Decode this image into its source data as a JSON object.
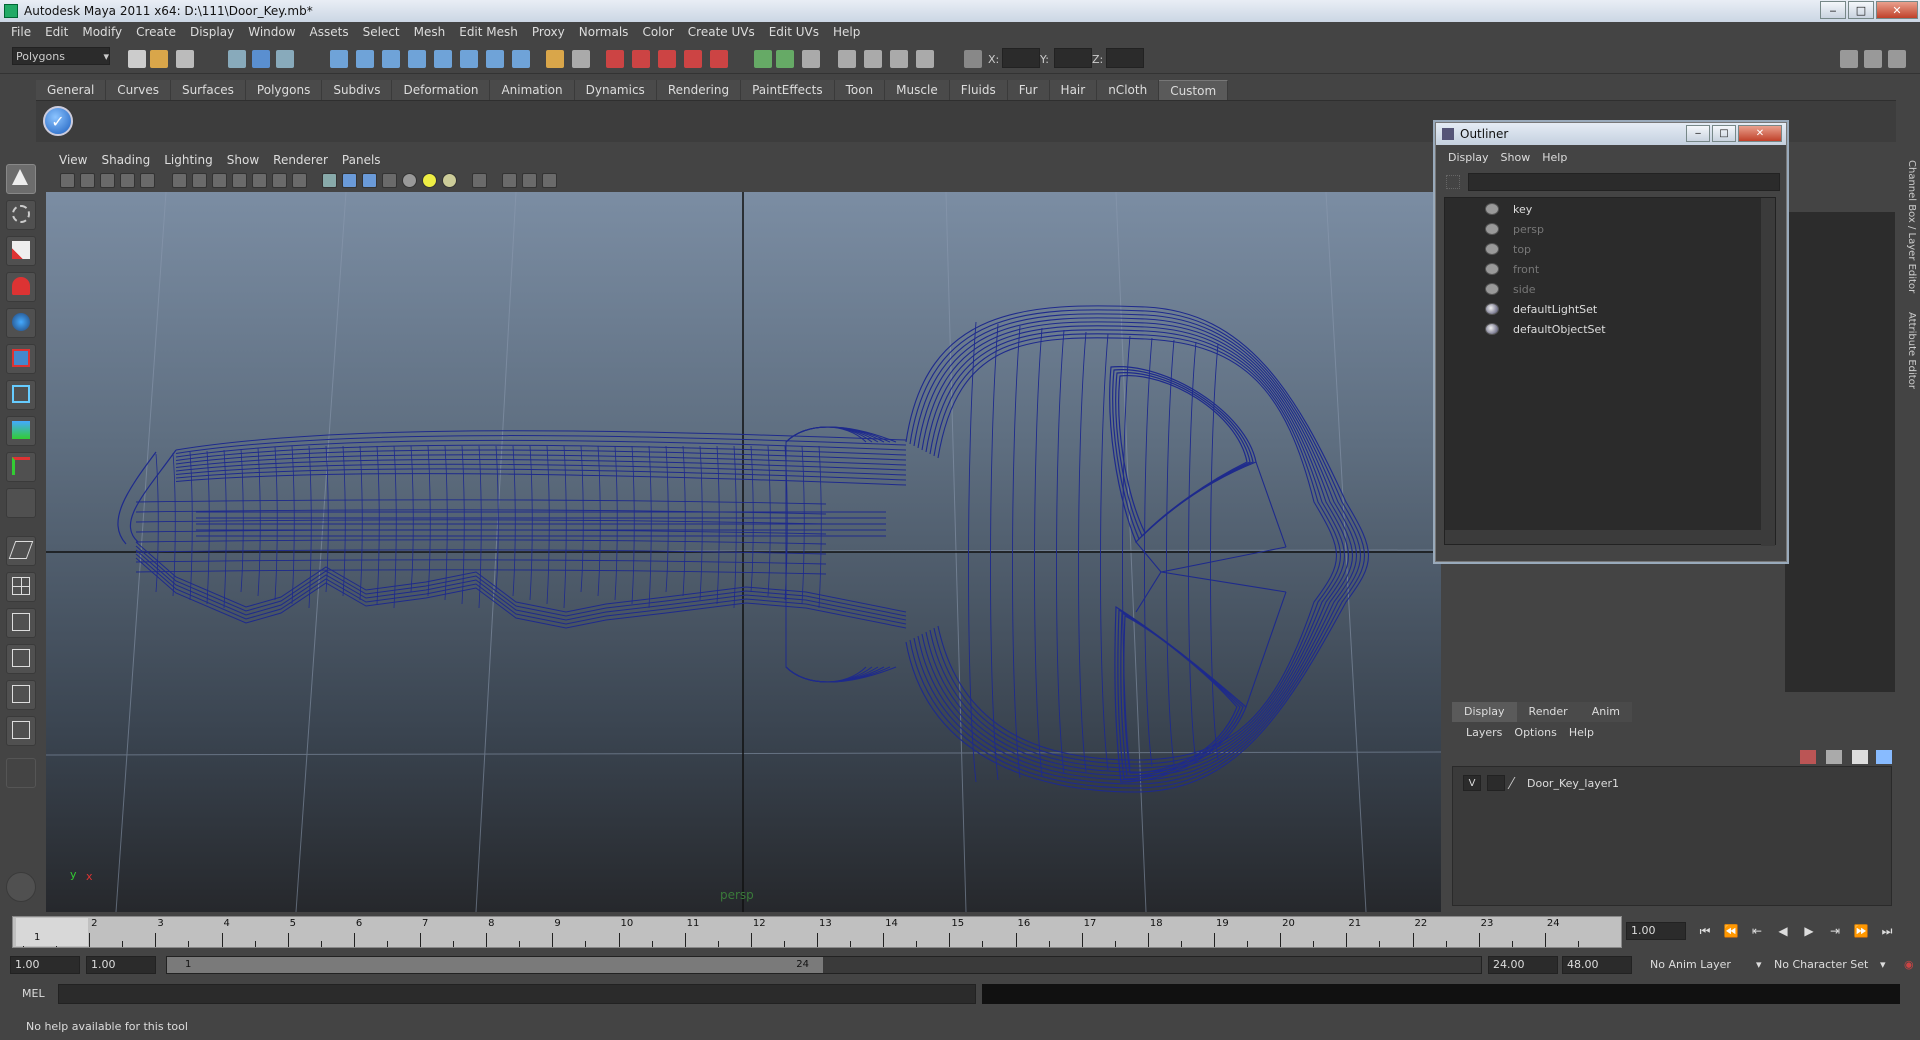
{
  "window": {
    "title": "Autodesk Maya 2011 x64: D:\\111\\Door_Key.mb*",
    "min": "‒",
    "max": "□",
    "close": "✕"
  },
  "menubar": [
    "File",
    "Edit",
    "Modify",
    "Create",
    "Display",
    "Window",
    "Assets",
    "Select",
    "Mesh",
    "Edit Mesh",
    "Proxy",
    "Normals",
    "Color",
    "Create UVs",
    "Edit UVs",
    "Help"
  ],
  "statusline": {
    "mode": "Polygons",
    "x_label": "X:",
    "y_label": "Y:",
    "z_label": "Z:"
  },
  "shelf_tabs": [
    "General",
    "Curves",
    "Surfaces",
    "Polygons",
    "Subdivs",
    "Deformation",
    "Animation",
    "Dynamics",
    "Rendering",
    "PaintEffects",
    "Toon",
    "Muscle",
    "Fluids",
    "Fur",
    "Hair",
    "nCloth",
    "Custom"
  ],
  "shelf_active": "Custom",
  "viewport": {
    "menus": [
      "View",
      "Shading",
      "Lighting",
      "Show",
      "Renderer",
      "Panels"
    ],
    "camera_label": "persp",
    "axis_x": "x",
    "axis_y": "y",
    "wire_color": "#1e2a8c"
  },
  "outliner": {
    "title": "Outliner",
    "menus": [
      "Display",
      "Show",
      "Help"
    ],
    "items": [
      {
        "label": "key",
        "dim": false,
        "icon": "mesh-icon"
      },
      {
        "label": "persp",
        "dim": true,
        "icon": "camera-icon"
      },
      {
        "label": "top",
        "dim": true,
        "icon": "camera-icon"
      },
      {
        "label": "front",
        "dim": true,
        "icon": "camera-icon"
      },
      {
        "label": "side",
        "dim": true,
        "icon": "camera-icon"
      },
      {
        "label": "defaultLightSet",
        "dim": false,
        "icon": "set-icon"
      },
      {
        "label": "defaultObjectSet",
        "dim": false,
        "icon": "set-icon"
      }
    ]
  },
  "side_tabs": [
    "Channel Box / Layer Editor",
    "Attribute Editor"
  ],
  "layers": {
    "tabs": [
      "Display",
      "Render",
      "Anim"
    ],
    "active_tab": "Display",
    "menus": [
      "Layers",
      "Options",
      "Help"
    ],
    "rows": [
      {
        "visible": "V",
        "name": "Door_Key_layer1"
      }
    ]
  },
  "timeline": {
    "ticks": [
      "1",
      "2",
      "3",
      "4",
      "5",
      "6",
      "7",
      "8",
      "9",
      "10",
      "11",
      "12",
      "13",
      "14",
      "15",
      "16",
      "17",
      "18",
      "19",
      "20",
      "21",
      "22",
      "23",
      "24"
    ],
    "current_frame_marker": "1",
    "current_time": "1.00"
  },
  "range": {
    "start": "1.00",
    "playback_start": "1.00",
    "handle_start": "1",
    "handle_end": "24",
    "playback_end": "24.00",
    "end": "48.00",
    "anim_layer": "No Anim Layer",
    "character_set": "No Character Set"
  },
  "cmdline": {
    "label": "MEL"
  },
  "help": {
    "text": "No help available for this tool"
  }
}
